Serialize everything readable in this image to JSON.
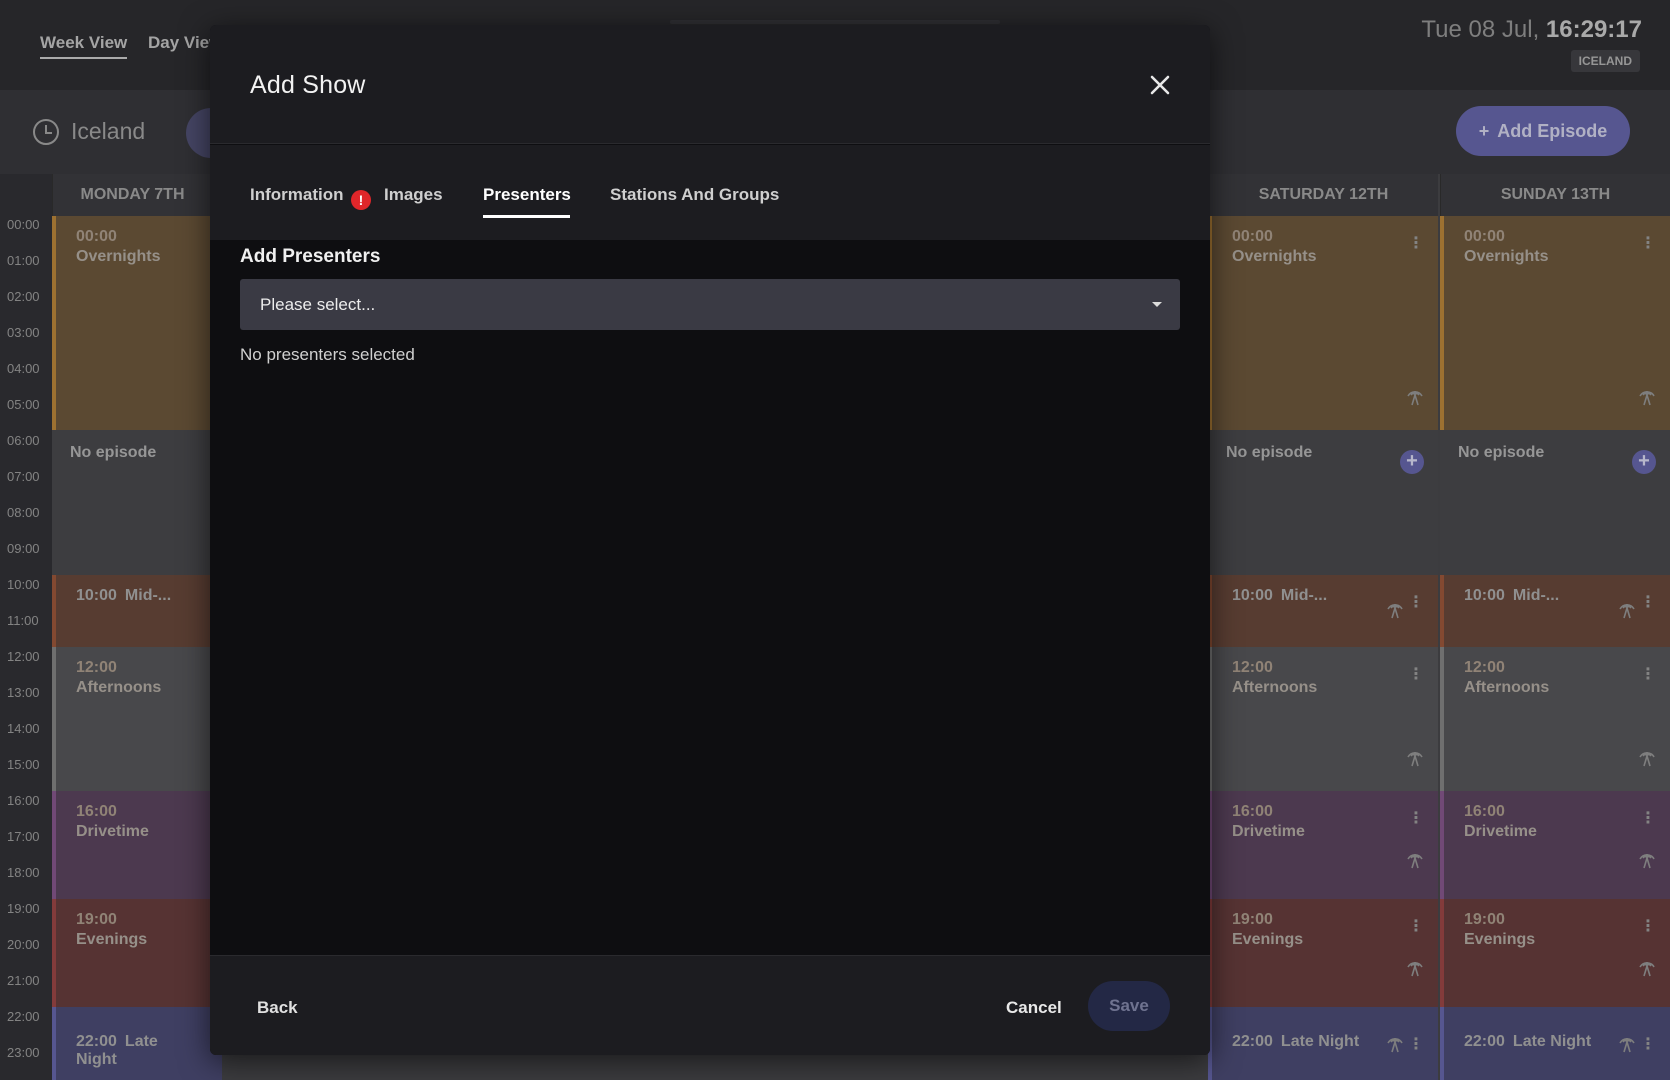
{
  "topbar": {
    "tabs": [
      "Week View",
      "Day View"
    ],
    "clock_date": "Tue 08 Jul, ",
    "clock_time": "16:29:17",
    "timezone_badge": "ICELAND"
  },
  "subbar": {
    "timezone": "Iceland",
    "add_episode": "Add Episode"
  },
  "calendar": {
    "times": [
      "00:00",
      "01:00",
      "02:00",
      "03:00",
      "04:00",
      "05:00",
      "06:00",
      "07:00",
      "08:00",
      "09:00",
      "10:00",
      "11:00",
      "12:00",
      "13:00",
      "14:00",
      "15:00",
      "16:00",
      "17:00",
      "18:00",
      "19:00",
      "20:00",
      "21:00",
      "22:00",
      "23:00"
    ],
    "days": {
      "monday": "MONDAY 7TH",
      "saturday": "SATURDAY 12TH",
      "sunday": "SUNDAY 13TH"
    },
    "slots": {
      "overnights_time": "00:00",
      "overnights_name": "Overnights",
      "no_episode": "No episode",
      "mid_time": "10:00",
      "mid_name": "Mid-...",
      "afternoons_time": "12:00",
      "afternoons_name": "Afternoons",
      "drivetime_time": "16:00",
      "drivetime_name": "Drivetime",
      "evenings_time": "19:00",
      "evenings_name": "Evenings",
      "late_time": "22:00",
      "late_name": "Late Night"
    }
  },
  "modal": {
    "title": "Add Show",
    "tabs": {
      "information": "Information",
      "images": "Images",
      "presenters": "Presenters",
      "stations": "Stations And Groups"
    },
    "error_badge": "!",
    "section_title": "Add Presenters",
    "select_placeholder": "Please select...",
    "empty_note": "No presenters selected",
    "footer": {
      "back": "Back",
      "cancel": "Cancel",
      "save": "Save"
    }
  },
  "colors": {
    "accent": "#6a6ab0",
    "error": "#e0262a",
    "modal_bg": "#0e0e11"
  }
}
